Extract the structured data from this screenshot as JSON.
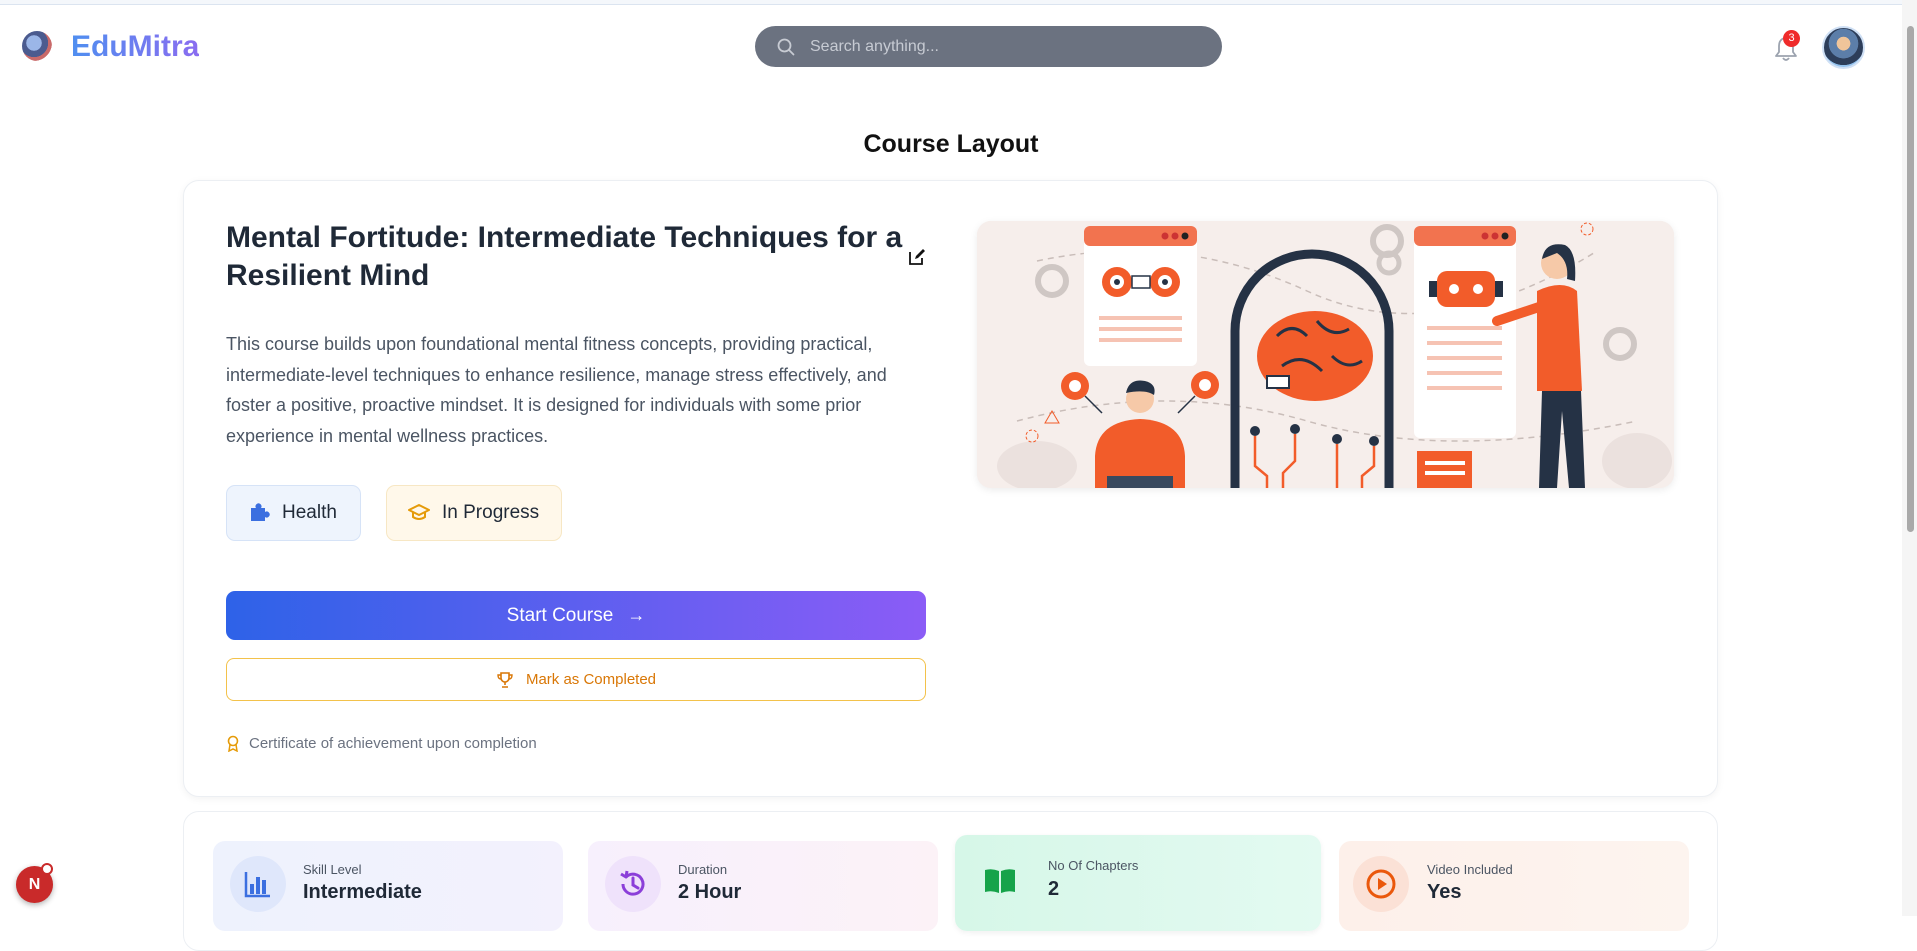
{
  "header": {
    "brand": "EduMitra",
    "search_placeholder": "Search anything...",
    "notification_count": "3"
  },
  "page": {
    "title": "Course Layout"
  },
  "course": {
    "title": "Mental Fortitude: Intermediate Techniques for a Resilient Mind",
    "description": "This course builds upon foundational mental fitness concepts, providing practical, intermediate-level techniques to enhance resilience, manage stress effectively, and foster a positive, proactive mindset. It is designed for individuals with some prior experience in mental wellness practices.",
    "category": "Health",
    "status": "In Progress",
    "start_label": "Start Course",
    "mark_label": "Mark as Completed",
    "certificate_note": "Certificate of achievement upon completion"
  },
  "stats": [
    {
      "label": "Skill Level",
      "value": "Intermediate",
      "icon": "bar-chart-icon",
      "color": "#3b6fe0"
    },
    {
      "label": "Duration",
      "value": "2 Hour",
      "icon": "history-clock-icon",
      "color": "#8b3fd9"
    },
    {
      "label": "No Of Chapters",
      "value": "2",
      "icon": "book-open-icon",
      "color": "#16a34a"
    },
    {
      "label": "Video Included",
      "value": "Yes",
      "icon": "play-circle-icon",
      "color": "#ea580c"
    }
  ],
  "colors": {
    "accent_start": "#2e62e8",
    "accent_end": "#8b5cf6",
    "warning": "#d97706",
    "illustration_orange": "#f25c2a"
  },
  "floating": {
    "n_label": "N"
  }
}
